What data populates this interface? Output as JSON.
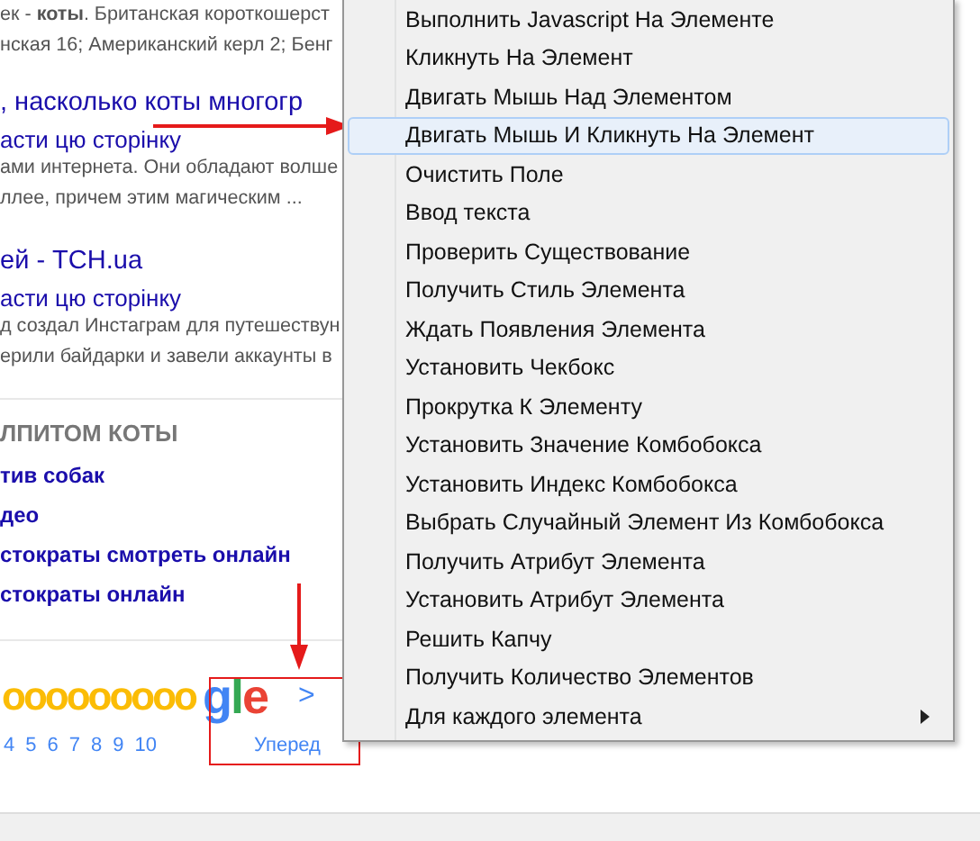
{
  "results": {
    "intro_lines": [
      "ек - **коты**. Британская короткошерст",
      "нская 16; Американский керл 2; Бенг"
    ],
    "items": [
      {
        "title": ", насколько коты многогр",
        "translate": "асти цю сторінку",
        "snippet": [
          "ами интернета. Они обладают волше",
          "ллее, причем этим магическим ..."
        ]
      },
      {
        "title": "ей - TCH.ua",
        "translate": "асти цю сторінку",
        "snippet": [
          "д создал Инстаграм для путешествун",
          "ерили байдарки и завели аккаунты в"
        ]
      }
    ]
  },
  "related": {
    "heading": "ЛПИТОМ КОТЫ",
    "links": [
      "тив собак",
      "део",
      "стократы смотреть онлайн",
      "стократы онлайн"
    ]
  },
  "pagination": {
    "logo_head": "ooooooooo",
    "logo_tail": "gle",
    "next_chevron": ">",
    "pages": [
      "4",
      "5",
      "6",
      "7",
      "8",
      "9",
      "10"
    ],
    "next_label": "Уперед"
  },
  "context_menu": {
    "items": [
      {
        "label": "Выполнить Javascript На Элементе",
        "selected": false,
        "submenu": false
      },
      {
        "label": "Кликнуть На Элемент",
        "selected": false,
        "submenu": false
      },
      {
        "label": "Двигать Мышь Над Элементом",
        "selected": false,
        "submenu": false
      },
      {
        "label": "Двигать Мышь И Кликнуть На Элемент",
        "selected": true,
        "submenu": false
      },
      {
        "label": "Очистить Поле",
        "selected": false,
        "submenu": false
      },
      {
        "label": "Ввод текста",
        "selected": false,
        "submenu": false
      },
      {
        "label": "Проверить Существование",
        "selected": false,
        "submenu": false
      },
      {
        "label": "Получить Стиль Элемента",
        "selected": false,
        "submenu": false
      },
      {
        "label": "Ждать Появления Элемента",
        "selected": false,
        "submenu": false
      },
      {
        "label": "Установить Чекбокс",
        "selected": false,
        "submenu": false
      },
      {
        "label": "Прокрутка К Элементу",
        "selected": false,
        "submenu": false
      },
      {
        "label": "Установить Значение Комбобокса",
        "selected": false,
        "submenu": false
      },
      {
        "label": "Установить Индекс Комбобокса",
        "selected": false,
        "submenu": false
      },
      {
        "label": "Выбрать Случайный Элемент Из Комбобокса",
        "selected": false,
        "submenu": false
      },
      {
        "label": "Получить Атрибут Элемента",
        "selected": false,
        "submenu": false
      },
      {
        "label": "Установить Атрибут Элемента",
        "selected": false,
        "submenu": false
      },
      {
        "label": "Решить Капчу",
        "selected": false,
        "submenu": false
      },
      {
        "label": "Получить Количество Элементов",
        "selected": false,
        "submenu": false
      },
      {
        "label": "Для каждого элемента",
        "selected": false,
        "submenu": true
      }
    ]
  }
}
